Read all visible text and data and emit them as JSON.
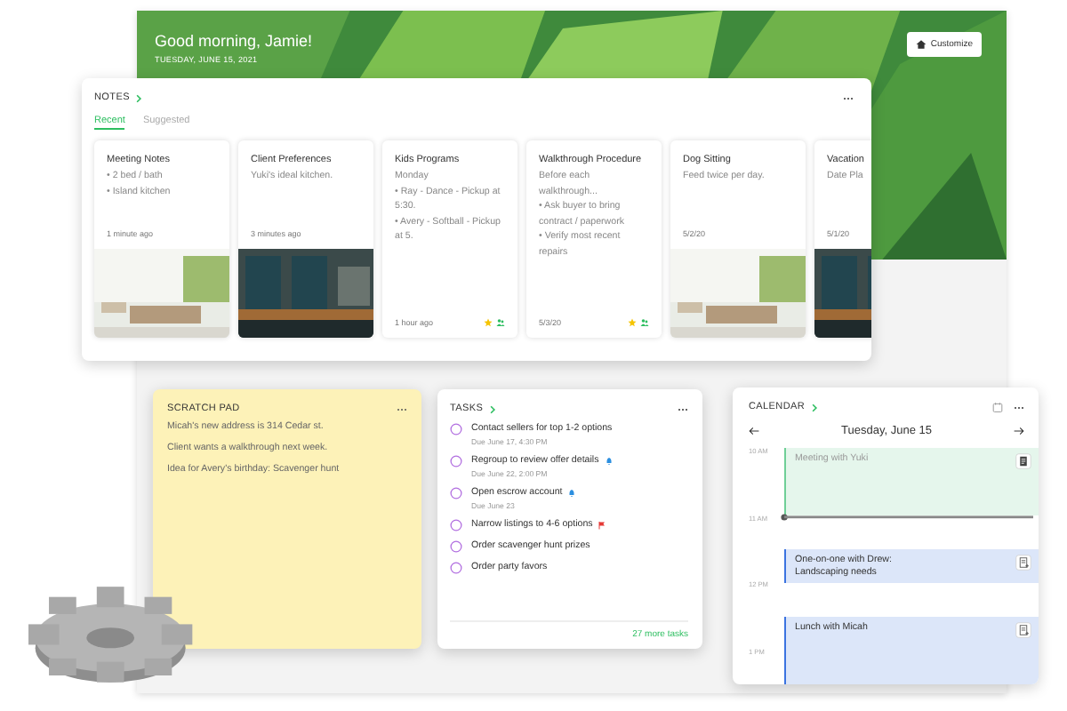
{
  "home": {
    "greeting": "Good morning, Jamie!",
    "date": "TUESDAY, JUNE 15, 2021",
    "customize": "Customize"
  },
  "notes": {
    "title": "NOTES",
    "tabs": [
      {
        "label": "Recent",
        "selected": true
      },
      {
        "label": "Suggested",
        "selected": false
      }
    ],
    "cards": [
      {
        "title": "Meeting Notes",
        "lines": [
          "• 2 bed / bath",
          "• Island kitchen"
        ],
        "time": "1 minute ago",
        "starred": false,
        "shared": false,
        "kind": "picture"
      },
      {
        "title": "Client Preferences",
        "lines": [
          "Yuki's ideal kitchen."
        ],
        "time": "3 minutes ago",
        "starred": false,
        "shared": false,
        "kind": "picture"
      },
      {
        "title": "Kids Programs",
        "lines": [
          "Monday",
          "• Ray - Dance - Pickup at 5:30.",
          "• Avery - Softball - Pickup at 5."
        ],
        "time": "1 hour ago",
        "starred": true,
        "shared": true,
        "kind": "text"
      },
      {
        "title": "Walkthrough Procedure",
        "lines": [
          "Before each walkthrough...",
          "• Ask buyer to bring contract / paperwork",
          "• Verify most recent repairs"
        ],
        "time": "5/3/20",
        "starred": true,
        "shared": true,
        "kind": "text"
      },
      {
        "title": "Dog Sitting",
        "lines": [
          "Feed twice per day."
        ],
        "time": "5/2/20",
        "starred": false,
        "shared": false,
        "kind": "picture"
      },
      {
        "title": "Vacation",
        "lines": [
          "Date Pla"
        ],
        "time": "5/1/20",
        "starred": false,
        "shared": false,
        "kind": "picture"
      }
    ]
  },
  "scratch_pad": {
    "title": "SCRATCH PAD",
    "lines": [
      "Micah's new address is 314 Cedar st.",
      "Client wants a walkthrough next week.",
      "Idea for Avery's birthday: Scavenger hunt"
    ]
  },
  "tasks": {
    "title": "TASKS",
    "items": [
      {
        "text": "Contact sellers for top 1-2 options",
        "due": "Due June 17, 4:30 PM",
        "checked": false,
        "kind": "plain"
      },
      {
        "text": "Regroup to review offer details",
        "due": "Due June 22, 2:00 PM",
        "checked": false,
        "kind": "reminder"
      },
      {
        "text": "Open escrow account",
        "due": "Due June 23",
        "checked": false,
        "kind": "reminder"
      },
      {
        "text": "Narrow listings to 4-6 options",
        "checked": false,
        "kind": "flag"
      },
      {
        "text": "Order scavenger hunt prizes",
        "checked": false,
        "kind": "plain"
      },
      {
        "text": "Order party favors",
        "checked": false,
        "kind": "plain"
      }
    ],
    "more": "27 more tasks"
  },
  "calendar": {
    "title": "CALENDAR",
    "date": "Tuesday, June 15",
    "hours": [
      "10 AM",
      "11 AM",
      "12 PM",
      "1 PM"
    ],
    "events": [
      {
        "title": "Meeting with Yuki",
        "color": "#6fcf97",
        "past": true
      },
      {
        "title": "One-on-one with Drew: Landscaping needs",
        "color": "#3b73e0",
        "past": false
      },
      {
        "title": "Lunch with Micah",
        "color": "#3b73e0",
        "past": false
      }
    ]
  }
}
